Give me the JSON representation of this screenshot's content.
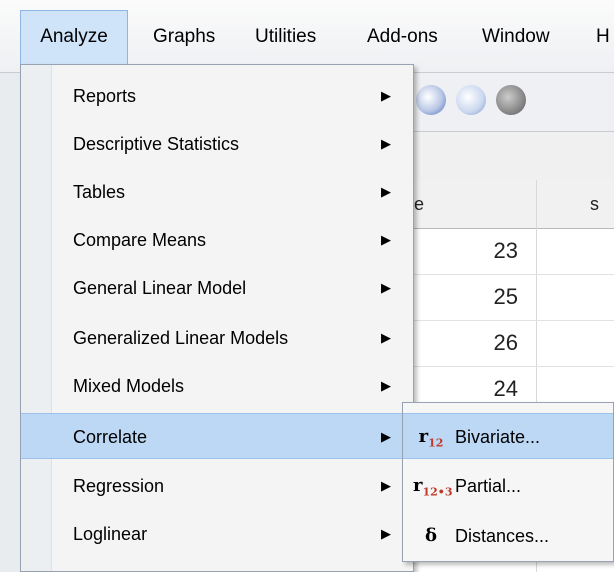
{
  "menubar": {
    "items": [
      {
        "label": "Analyze",
        "mnemonic_index": 0
      },
      {
        "label": "Graphs",
        "mnemonic_index": 0
      },
      {
        "label": "Utilities",
        "mnemonic_index": 0
      },
      {
        "label": "Add-ons",
        "mnemonic_index": 5
      },
      {
        "label": "Window",
        "mnemonic_index": 0
      },
      {
        "label": "H",
        "mnemonic_index": 0
      }
    ],
    "active": "Analyze"
  },
  "grid": {
    "headers": [
      "e",
      "s"
    ],
    "rows": [
      "23",
      "25",
      "26",
      "24"
    ]
  },
  "analyze_menu": {
    "items": [
      {
        "label": "Reports",
        "has_submenu": true
      },
      {
        "label": "Descriptive Statistics",
        "has_submenu": true
      },
      {
        "label": "Tables",
        "has_submenu": true
      },
      {
        "label": "Compare Means",
        "has_submenu": true
      },
      {
        "label": "General Linear Model",
        "has_submenu": true
      },
      {
        "label": "Generalized Linear Models",
        "has_submenu": true
      },
      {
        "label": "Mixed Models",
        "has_submenu": true
      },
      {
        "label": "Correlate",
        "has_submenu": true,
        "highlighted": true
      },
      {
        "label": "Regression",
        "has_submenu": true
      },
      {
        "label": "Loglinear",
        "has_submenu": true
      }
    ],
    "arrow_glyph": "▶"
  },
  "correlate_submenu": {
    "items": [
      {
        "label": "Bivariate...",
        "icon": "r12-icon",
        "icon_text": "r",
        "icon_sub": "12",
        "highlighted": true
      },
      {
        "label": "Partial...",
        "icon": "r12-3-icon",
        "icon_text": "r",
        "icon_sub": "12•3"
      },
      {
        "label": "Distances...",
        "icon": "delta-icon",
        "icon_text": "δ",
        "icon_sub": ""
      }
    ]
  },
  "colors": {
    "highlight": "#bcd8f5",
    "menu_bg": "#f4f4f4"
  }
}
